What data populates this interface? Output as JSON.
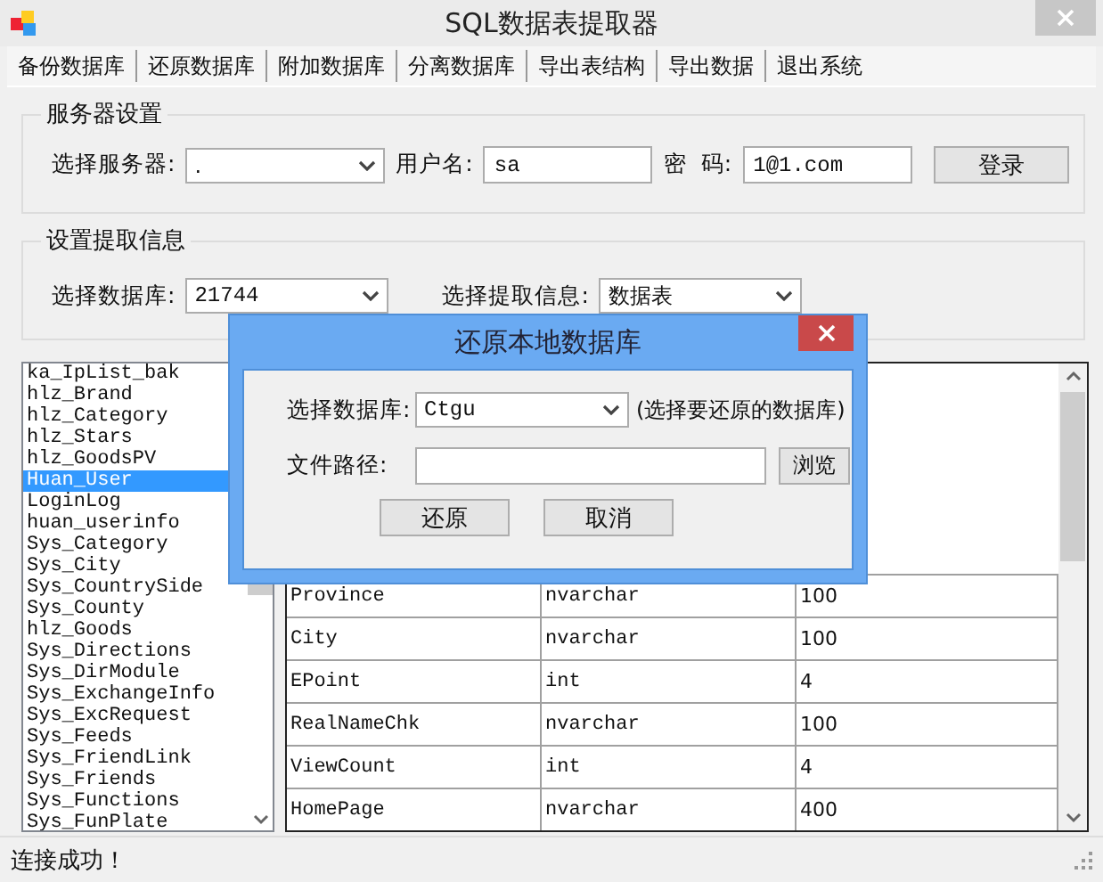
{
  "window": {
    "title": "SQL数据表提取器"
  },
  "menu": [
    {
      "label": "备份数据库"
    },
    {
      "label": "还原数据库"
    },
    {
      "label": "附加数据库"
    },
    {
      "label": "分离数据库"
    },
    {
      "label": "导出表结构"
    },
    {
      "label": "导出数据"
    },
    {
      "label": "退出系统"
    }
  ],
  "server_group": {
    "title": "服务器设置",
    "server_label": "选择服务器:",
    "server_value": ".",
    "user_label": "用户名:",
    "user_value": "sa",
    "password_label": "密  码:",
    "password_value": "1@1.com",
    "login_button": "登录"
  },
  "extract_group": {
    "title": "设置提取信息",
    "database_label": "选择数据库:",
    "database_value": "21744",
    "info_label": "选择提取信息:",
    "info_value": "数据表"
  },
  "table_list": [
    {
      "name": "ka_IpList_bak",
      "selected": false
    },
    {
      "name": "hlz_Brand",
      "selected": false
    },
    {
      "name": "hlz_Category",
      "selected": false
    },
    {
      "name": "hlz_Stars",
      "selected": false
    },
    {
      "name": "hlz_GoodsPV",
      "selected": false
    },
    {
      "name": "Huan_User",
      "selected": true
    },
    {
      "name": "LoginLog",
      "selected": false
    },
    {
      "name": "huan_userinfo",
      "selected": false
    },
    {
      "name": "Sys_Category",
      "selected": false
    },
    {
      "name": "Sys_City",
      "selected": false
    },
    {
      "name": "Sys_CountrySide",
      "selected": false
    },
    {
      "name": "Sys_County",
      "selected": false
    },
    {
      "name": "hlz_Goods",
      "selected": false
    },
    {
      "name": "Sys_Directions",
      "selected": false
    },
    {
      "name": "Sys_DirModule",
      "selected": false
    },
    {
      "name": "Sys_ExchangeInfo",
      "selected": false
    },
    {
      "name": "Sys_ExcRequest",
      "selected": false
    },
    {
      "name": "Sys_Feeds",
      "selected": false
    },
    {
      "name": "Sys_FriendLink",
      "selected": false
    },
    {
      "name": "Sys_Friends",
      "selected": false
    },
    {
      "name": "Sys_Functions",
      "selected": false
    },
    {
      "name": "Sys_FunPlate",
      "selected": false
    }
  ],
  "fields_table": {
    "rows": [
      [
        "Province",
        "nvarchar",
        "100"
      ],
      [
        "City",
        "nvarchar",
        "100"
      ],
      [
        "EPoint",
        "int",
        "4"
      ],
      [
        "RealNameChk",
        "nvarchar",
        "100"
      ],
      [
        "ViewCount",
        "int",
        "4"
      ],
      [
        "HomePage",
        "nvarchar",
        "400"
      ]
    ]
  },
  "status_bar": {
    "text": "连接成功！"
  },
  "dialog": {
    "title": "还原本地数据库",
    "database_label": "选择数据库:",
    "database_value": "Ctgu",
    "database_hint": "(选择要还原的数据库)",
    "path_label": "文件路径:",
    "browse_button": "浏览",
    "restore_button": "还原",
    "cancel_button": "取消"
  }
}
